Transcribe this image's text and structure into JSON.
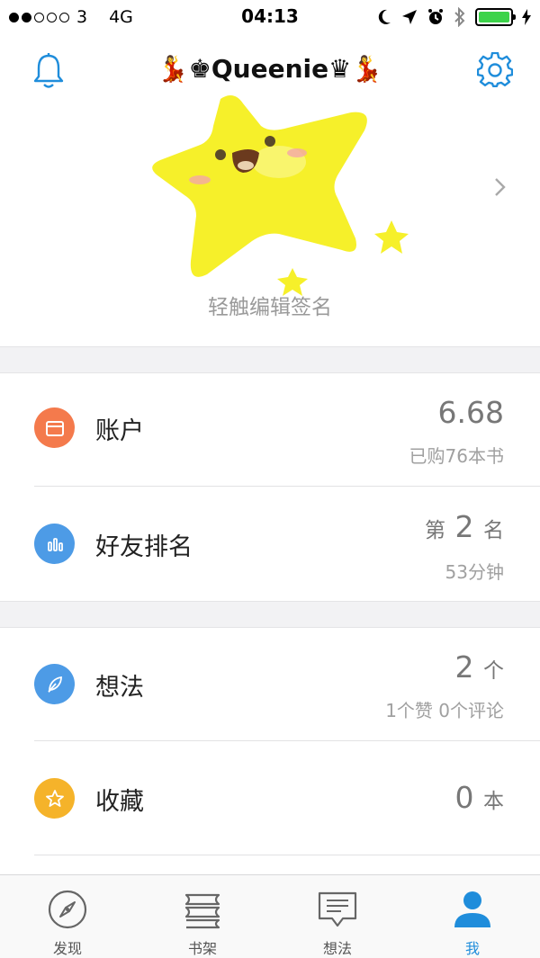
{
  "status": {
    "carrier": "3",
    "network": "4G",
    "time": "04:13"
  },
  "header": {
    "username": "💃♚Queenie♛💃",
    "bell_icon": "bell-icon",
    "settings_icon": "gear-icon"
  },
  "profile": {
    "signature_placeholder": "轻触编辑签名"
  },
  "rows": {
    "account": {
      "label": "账户",
      "value": "6.68",
      "sub": "已购76本书",
      "icon_color": "#f47a4c"
    },
    "ranking": {
      "label": "好友排名",
      "value_prefix": "第",
      "value": "2",
      "value_suffix": "名",
      "sub": "53分钟",
      "icon_color": "#4d9be6"
    },
    "thoughts": {
      "label": "想法",
      "value": "2",
      "value_suffix": "个",
      "sub": "1个赞 0个评论",
      "icon_color": "#4d9be6"
    },
    "favorites": {
      "label": "收藏",
      "value": "0",
      "value_suffix": "本",
      "icon_color": "#f5b32a"
    }
  },
  "tabbar": {
    "tabs": [
      {
        "label": "发现",
        "icon": "compass-icon"
      },
      {
        "label": "书架",
        "icon": "bookshelf-icon"
      },
      {
        "label": "想法",
        "icon": "comment-icon"
      },
      {
        "label": "我",
        "icon": "person-icon"
      }
    ],
    "active_color": "#1f8ddb"
  }
}
